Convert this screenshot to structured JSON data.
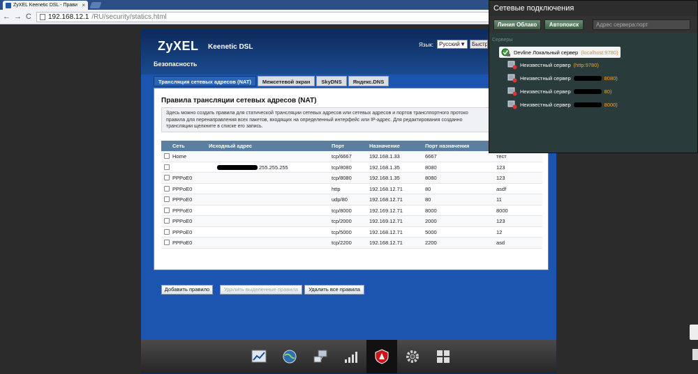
{
  "browser": {
    "tab_title": "ZyXEL Keenetic DSL - Прави",
    "tab_close": "×",
    "url_host": "192.168.12.1",
    "url_path": "/RU/security/statics.html",
    "back": "←",
    "forward": "→",
    "reload": "C"
  },
  "app": {
    "logo": "ZyXEL",
    "product": "Keenetic DSL",
    "language_label": "Язык:",
    "language_value": "Русский",
    "language_arrow": "▼",
    "language_button": "Быстр",
    "section_title": "Безопасность",
    "subtabs": [
      {
        "label": "Трансляция сетевых адресов (NAT)",
        "active": true
      },
      {
        "label": "Межсетевой экран",
        "active": false
      },
      {
        "label": "SkyDNS",
        "active": false
      },
      {
        "label": "Яндекс.DNS",
        "active": false
      }
    ],
    "content_title": "Правила трансляции сетевых адресов (NAT)",
    "description": "Здесь можно создать правила для статической трансляции сетевых адресов или сетевых адресов и портов транслпортного протоко правила для перенаправления всех пакетов, входящих на определенный интерфейс или IP-адрес. Для редактирования созданно трансляции щелкните в списке его запись.",
    "table": {
      "headers": [
        "Сеть",
        "Исходный адрес",
        "Порт",
        "Назначение",
        "Порт назначения",
        ""
      ],
      "rows": [
        {
          "net": "Home",
          "src": "",
          "port": "tcp/6667",
          "dst": "192.168.1.33",
          "dport": "6667",
          "desc": "тест"
        },
        {
          "net": "",
          "src": "255.255.255",
          "port": "tcp/8080",
          "dst": "192.168.1.35",
          "dport": "8080",
          "desc": "123"
        },
        {
          "net": "PPPoE0",
          "src": "",
          "port": "tcp/8080",
          "dst": "192.168.1.35",
          "dport": "8080",
          "desc": "123"
        },
        {
          "net": "PPPoE0",
          "src": "",
          "port": "http",
          "dst": "192.168.12.71",
          "dport": "80",
          "desc": "asdf"
        },
        {
          "net": "PPPoE0",
          "src": "",
          "port": "udp/80",
          "dst": "192.168.12.71",
          "dport": "80",
          "desc": "11"
        },
        {
          "net": "PPPoE0",
          "src": "",
          "port": "tcp/8000",
          "dst": "192.169.12.71",
          "dport": "8000",
          "desc": "8000"
        },
        {
          "net": "PPPoE0",
          "src": "",
          "port": "tcp/2000",
          "dst": "192.169.12.71",
          "dport": "2000",
          "desc": "123"
        },
        {
          "net": "PPPoE0",
          "src": "",
          "port": "tcp/5000",
          "dst": "192.168.12.71",
          "dport": "5000",
          "desc": "12"
        },
        {
          "net": "PPPoE0",
          "src": "",
          "port": "tcp/2200",
          "dst": "192.168.12.71",
          "dport": "2200",
          "desc": "asd"
        }
      ]
    },
    "buttons": {
      "add": "Добавить правило",
      "delete_selected": "Удалить выделенные правила",
      "delete_all": "Удалить все правила"
    },
    "dock_icons": [
      "chart-icon",
      "globe-icon",
      "network-icon",
      "signal-icon",
      "shield-icon",
      "gear-icon",
      "apps-icon"
    ]
  },
  "panel": {
    "title": "Сетевые подключения",
    "btn_cloud": "Линия Облако",
    "btn_autosearch": "Автопоиск",
    "address_placeholder": "Адрес сервера:порт",
    "list_title": "Серверы",
    "servers": [
      {
        "name": "Devline Локальный сервер",
        "addr": "(localhost:9780)",
        "selected": true
      },
      {
        "name": "Неизвестный сервер",
        "addr": "(http:9780)",
        "selected": false
      },
      {
        "name": "Неизвестный сервер",
        "addr": "8080)",
        "selected": false
      },
      {
        "name": "Неизвестный сервер",
        "addr": "80)",
        "selected": false
      },
      {
        "name": "Неизвестный сервер",
        "addr": "8000)",
        "selected": false
      }
    ]
  }
}
